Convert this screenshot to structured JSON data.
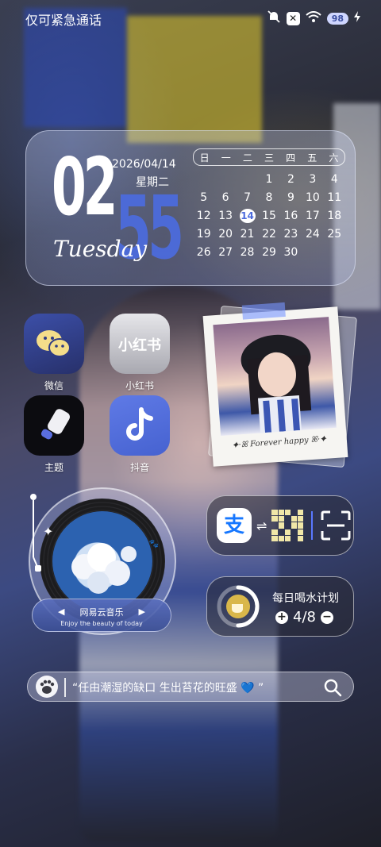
{
  "status_bar": {
    "carrier": "仅可紧急通话",
    "battery": "98",
    "icons": [
      "mute-icon",
      "x-icon",
      "wifi-icon",
      "battery-icon",
      "charging-icon"
    ]
  },
  "clock_widget": {
    "hour": "02",
    "minute": "55",
    "date": "2026/04/14",
    "weekday_cn": "星期二",
    "weekday_en": "Tuesday",
    "calendar": {
      "headers": [
        "日",
        "一",
        "二",
        "三",
        "四",
        "五",
        "六"
      ],
      "rows": [
        [
          "",
          "",
          "",
          "1",
          "2",
          "3",
          "4"
        ],
        [
          "5",
          "6",
          "7",
          "8",
          "9",
          "10",
          "11"
        ],
        [
          "12",
          "13",
          "14",
          "15",
          "16",
          "17",
          "18"
        ],
        [
          "19",
          "20",
          "21",
          "22",
          "23",
          "24",
          "25"
        ],
        [
          "26",
          "27",
          "28",
          "29",
          "30",
          "",
          ""
        ]
      ],
      "today": "14"
    }
  },
  "apps": [
    {
      "label": "微信",
      "icon": "wechat-icon"
    },
    {
      "label": "小红书",
      "icon": "xiaohongshu-icon",
      "logo_text": "小红书"
    },
    {
      "label": "主题",
      "icon": "theme-icon"
    },
    {
      "label": "抖音",
      "icon": "douyin-icon"
    }
  ],
  "photo_widget": {
    "caption": "✦·ꕤ Forever happy ꕤ·✦"
  },
  "music_widget": {
    "title": "网易云音乐",
    "subtitle": "Enjoy the beauty of today",
    "prev_icon": "◀",
    "next_icon": "▶"
  },
  "alipay_widget": {
    "logo_text": "支",
    "swap_icon": "⇌"
  },
  "water_widget": {
    "label": "每日喝水计划",
    "progress": "4/8",
    "progress_fraction": 0.5,
    "plus": "+",
    "minus": "−"
  },
  "search_bar": {
    "quote": "“任由潮湿的缺口 生出苔花的旺盛 💙 ”"
  },
  "colors": {
    "accent_blue": "#4c6bdc",
    "alipay_blue": "#1677ff",
    "qr_yellow": "#f1e7a8"
  }
}
